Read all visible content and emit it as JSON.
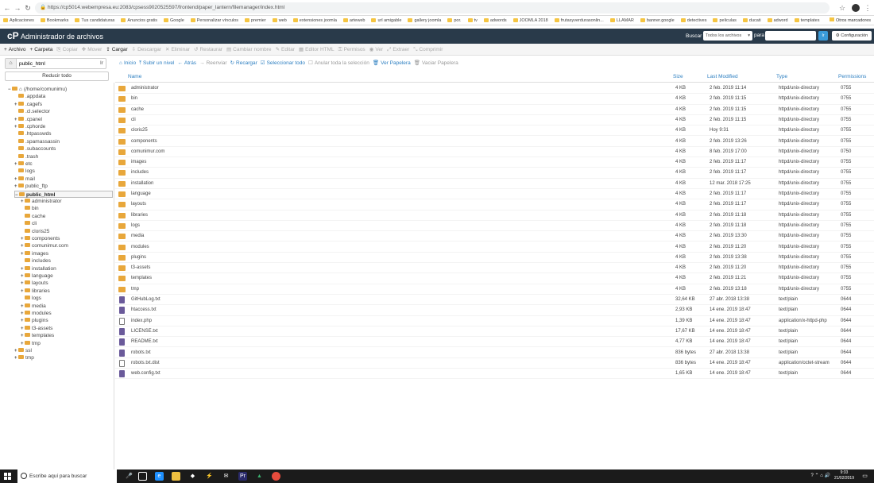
{
  "browser": {
    "url": "https://cp5014.webempresa.eu:2083/cpsess9020525597/frontend/paper_lantern/filemanager/index.html",
    "bookmarks": [
      "Aplicaciones",
      "Bookmarks",
      "Tus candidaturas",
      "Anuncios gratis",
      "Google",
      "Personalizar vínculos",
      "premier",
      "web",
      "extensiones joomla",
      "arteweb",
      "url amigable",
      "gallery joomla",
      "por.",
      "tv",
      "adwords",
      "JOOMLA 2018",
      "frutasyverdurasonlin...",
      "LLAMAR",
      "banner.google",
      "detectives",
      "peliculas",
      "ducati",
      "adword",
      "templates"
    ],
    "other_bookmarks": "Otros marcadores"
  },
  "header": {
    "title": "Administrador de archivos",
    "search_label": "Buscar",
    "search_scope": "Todos los archivos",
    "for_label": "para",
    "go_label": "Ir",
    "settings_label": "Configuración"
  },
  "toolbar": [
    {
      "label": "Archivo",
      "icon": "+",
      "on": true
    },
    {
      "label": "Carpeta",
      "icon": "+",
      "on": true
    },
    {
      "label": "Copiar",
      "icon": "⎘",
      "on": false
    },
    {
      "label": "Mover",
      "icon": "✥",
      "on": false
    },
    {
      "label": "Cargar",
      "icon": "⇪",
      "on": true
    },
    {
      "label": "Descargar",
      "icon": "⇩",
      "on": false
    },
    {
      "label": "Eliminar",
      "icon": "✕",
      "on": false
    },
    {
      "label": "Restaurar",
      "icon": "↺",
      "on": false
    },
    {
      "label": "Cambiar nombre",
      "icon": "▤",
      "on": false
    },
    {
      "label": "Editar",
      "icon": "✎",
      "on": false
    },
    {
      "label": "Editor HTML",
      "icon": "▦",
      "on": false
    },
    {
      "label": "Permisos",
      "icon": "⚿",
      "on": false
    },
    {
      "label": "Ver",
      "icon": "◉",
      "on": false
    },
    {
      "label": "Extraer",
      "icon": "⤢",
      "on": false
    },
    {
      "label": "Comprimir",
      "icon": "⤡",
      "on": false
    }
  ],
  "nav": {
    "path": "public_html",
    "path_go": "Ir",
    "collapse_label": "Reducir todo",
    "buttons": [
      {
        "label": "Inicio",
        "icon": "⌂",
        "on": true
      },
      {
        "label": "Subir un nivel",
        "icon": "⤒",
        "on": true
      },
      {
        "label": "Atrás",
        "icon": "←",
        "on": true
      },
      {
        "label": "Reenviar",
        "icon": "→",
        "on": false
      },
      {
        "label": "Recargar",
        "icon": "↻",
        "on": true
      },
      {
        "label": "Seleccionar todo",
        "icon": "☑",
        "on": true
      },
      {
        "label": "Anular toda la selección",
        "icon": "☐",
        "on": false
      },
      {
        "label": "Ver Papelera",
        "icon": "🗑",
        "on": true
      },
      {
        "label": "Vaciar Papelera",
        "icon": "🗑",
        "on": false
      }
    ]
  },
  "tree": [
    {
      "label": "(/home/comunimu)",
      "depth": 0,
      "exp": "−",
      "home": true
    },
    {
      "label": ".appdata",
      "depth": 1,
      "exp": ""
    },
    {
      "label": ".cagefs",
      "depth": 1,
      "exp": "+"
    },
    {
      "label": ".cl.selector",
      "depth": 1,
      "exp": ""
    },
    {
      "label": ".cpanel",
      "depth": 1,
      "exp": "+"
    },
    {
      "label": ".cphorde",
      "depth": 1,
      "exp": "+"
    },
    {
      "label": ".htpasswds",
      "depth": 1,
      "exp": ""
    },
    {
      "label": ".spamassassin",
      "depth": 1,
      "exp": ""
    },
    {
      "label": ".subaccounts",
      "depth": 1,
      "exp": ""
    },
    {
      "label": ".trash",
      "depth": 1,
      "exp": ""
    },
    {
      "label": "etc",
      "depth": 1,
      "exp": "+"
    },
    {
      "label": "logs",
      "depth": 1,
      "exp": ""
    },
    {
      "label": "mail",
      "depth": 1,
      "exp": "+"
    },
    {
      "label": "public_ftp",
      "depth": 1,
      "exp": "+"
    },
    {
      "label": "public_html",
      "depth": 1,
      "exp": "−",
      "sel": true
    },
    {
      "label": "administrator",
      "depth": 2,
      "exp": "+"
    },
    {
      "label": "bin",
      "depth": 2,
      "exp": ""
    },
    {
      "label": "cache",
      "depth": 2,
      "exp": ""
    },
    {
      "label": "cli",
      "depth": 2,
      "exp": ""
    },
    {
      "label": "cloris25",
      "depth": 2,
      "exp": ""
    },
    {
      "label": "components",
      "depth": 2,
      "exp": "+"
    },
    {
      "label": "comunimur.com",
      "depth": 2,
      "exp": "+"
    },
    {
      "label": "images",
      "depth": 2,
      "exp": "+"
    },
    {
      "label": "includes",
      "depth": 2,
      "exp": ""
    },
    {
      "label": "installation",
      "depth": 2,
      "exp": "+"
    },
    {
      "label": "language",
      "depth": 2,
      "exp": "+"
    },
    {
      "label": "layouts",
      "depth": 2,
      "exp": "+"
    },
    {
      "label": "libraries",
      "depth": 2,
      "exp": "+"
    },
    {
      "label": "logs",
      "depth": 2,
      "exp": ""
    },
    {
      "label": "media",
      "depth": 2,
      "exp": "+"
    },
    {
      "label": "modules",
      "depth": 2,
      "exp": "+"
    },
    {
      "label": "plugins",
      "depth": 2,
      "exp": "+"
    },
    {
      "label": "t3-assets",
      "depth": 2,
      "exp": "+"
    },
    {
      "label": "templates",
      "depth": 2,
      "exp": "+"
    },
    {
      "label": "tmp",
      "depth": 2,
      "exp": "+"
    },
    {
      "label": "ssl",
      "depth": 1,
      "exp": "+"
    },
    {
      "label": "tmp",
      "depth": 1,
      "exp": "+"
    }
  ],
  "columns": {
    "name": "Name",
    "size": "Size",
    "modified": "Last Modified",
    "type": "Type",
    "perms": "Permissions"
  },
  "files": [
    {
      "name": "administrator",
      "size": "4 KB",
      "modified": "2 feb. 2019 11:14",
      "type": "httpd/unix-directory",
      "perms": "0755",
      "kind": "folder"
    },
    {
      "name": "bin",
      "size": "4 KB",
      "modified": "2 feb. 2019 11:15",
      "type": "httpd/unix-directory",
      "perms": "0755",
      "kind": "folder"
    },
    {
      "name": "cache",
      "size": "4 KB",
      "modified": "2 feb. 2019 11:15",
      "type": "httpd/unix-directory",
      "perms": "0755",
      "kind": "folder"
    },
    {
      "name": "cli",
      "size": "4 KB",
      "modified": "2 feb. 2019 11:15",
      "type": "httpd/unix-directory",
      "perms": "0755",
      "kind": "folder"
    },
    {
      "name": "cloris25",
      "size": "4 KB",
      "modified": "Hoy 9:31",
      "type": "httpd/unix-directory",
      "perms": "0755",
      "kind": "folder"
    },
    {
      "name": "components",
      "size": "4 KB",
      "modified": "2 feb. 2019 13:26",
      "type": "httpd/unix-directory",
      "perms": "0755",
      "kind": "folder"
    },
    {
      "name": "comunimur.com",
      "size": "4 KB",
      "modified": "8 feb. 2019 17:00",
      "type": "httpd/unix-directory",
      "perms": "0750",
      "kind": "folder"
    },
    {
      "name": "images",
      "size": "4 KB",
      "modified": "2 feb. 2019 11:17",
      "type": "httpd/unix-directory",
      "perms": "0755",
      "kind": "folder"
    },
    {
      "name": "includes",
      "size": "4 KB",
      "modified": "2 feb. 2019 11:17",
      "type": "httpd/unix-directory",
      "perms": "0755",
      "kind": "folder"
    },
    {
      "name": "installation",
      "size": "4 KB",
      "modified": "12 mar. 2018 17:25",
      "type": "httpd/unix-directory",
      "perms": "0755",
      "kind": "folder"
    },
    {
      "name": "language",
      "size": "4 KB",
      "modified": "2 feb. 2019 11:17",
      "type": "httpd/unix-directory",
      "perms": "0755",
      "kind": "folder"
    },
    {
      "name": "layouts",
      "size": "4 KB",
      "modified": "2 feb. 2019 11:17",
      "type": "httpd/unix-directory",
      "perms": "0755",
      "kind": "folder"
    },
    {
      "name": "libraries",
      "size": "4 KB",
      "modified": "2 feb. 2019 11:18",
      "type": "httpd/unix-directory",
      "perms": "0755",
      "kind": "folder"
    },
    {
      "name": "logs",
      "size": "4 KB",
      "modified": "2 feb. 2019 11:18",
      "type": "httpd/unix-directory",
      "perms": "0755",
      "kind": "folder"
    },
    {
      "name": "media",
      "size": "4 KB",
      "modified": "2 feb. 2019 13:30",
      "type": "httpd/unix-directory",
      "perms": "0755",
      "kind": "folder"
    },
    {
      "name": "modules",
      "size": "4 KB",
      "modified": "2 feb. 2019 11:20",
      "type": "httpd/unix-directory",
      "perms": "0755",
      "kind": "folder"
    },
    {
      "name": "plugins",
      "size": "4 KB",
      "modified": "2 feb. 2019 13:38",
      "type": "httpd/unix-directory",
      "perms": "0755",
      "kind": "folder"
    },
    {
      "name": "t3-assets",
      "size": "4 KB",
      "modified": "2 feb. 2019 11:20",
      "type": "httpd/unix-directory",
      "perms": "0755",
      "kind": "folder"
    },
    {
      "name": "templates",
      "size": "4 KB",
      "modified": "2 feb. 2019 11:21",
      "type": "httpd/unix-directory",
      "perms": "0755",
      "kind": "folder"
    },
    {
      "name": "tmp",
      "size": "4 KB",
      "modified": "2 feb. 2019 13:18",
      "type": "httpd/unix-directory",
      "perms": "0755",
      "kind": "folder"
    },
    {
      "name": "GitHubLog.txt",
      "size": "32,64 KB",
      "modified": "27 abr. 2018 13:38",
      "type": "text/plain",
      "perms": "0644",
      "kind": "file"
    },
    {
      "name": "htaccess.txt",
      "size": "2,93 KB",
      "modified": "14 ene. 2019 18:47",
      "type": "text/plain",
      "perms": "0644",
      "kind": "file"
    },
    {
      "name": "index.php",
      "size": "1,39 KB",
      "modified": "14 ene. 2019 18:47",
      "type": "application/x-httpd-php",
      "perms": "0644",
      "kind": "file-blank"
    },
    {
      "name": "LICENSE.txt",
      "size": "17,67 KB",
      "modified": "14 ene. 2019 18:47",
      "type": "text/plain",
      "perms": "0644",
      "kind": "file"
    },
    {
      "name": "README.txt",
      "size": "4,77 KB",
      "modified": "14 ene. 2019 18:47",
      "type": "text/plain",
      "perms": "0644",
      "kind": "file"
    },
    {
      "name": "robots.txt",
      "size": "836 bytes",
      "modified": "27 abr. 2018 13:38",
      "type": "text/plain",
      "perms": "0644",
      "kind": "file"
    },
    {
      "name": "robots.txt.dist",
      "size": "836 bytes",
      "modified": "14 ene. 2019 18:47",
      "type": "application/octet-stream",
      "perms": "0644",
      "kind": "file-blank"
    },
    {
      "name": "web.config.txt",
      "size": "1,65 KB",
      "modified": "14 ene. 2019 18:47",
      "type": "text/plain",
      "perms": "0644",
      "kind": "file"
    }
  ],
  "taskbar": {
    "search_placeholder": "Escribe aquí para buscar",
    "time": "9:33",
    "date": "21/02/2019"
  }
}
